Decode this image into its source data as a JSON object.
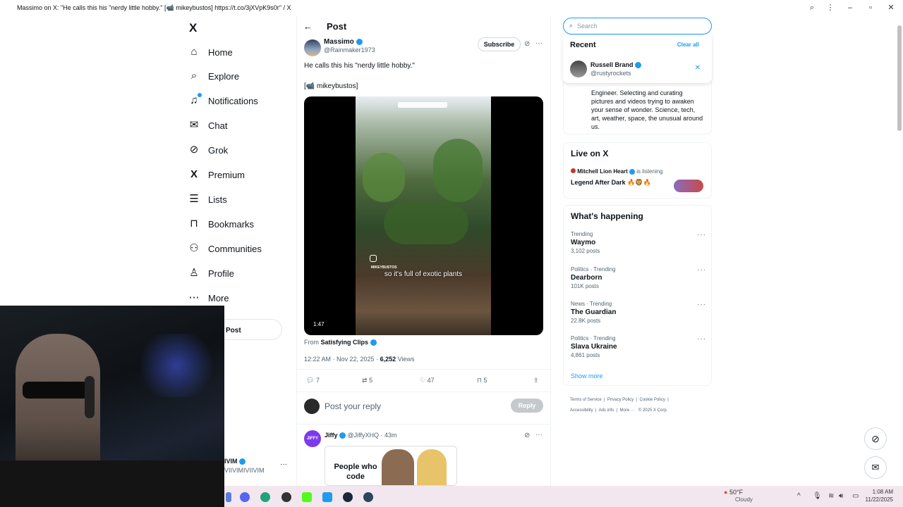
{
  "window": {
    "title": "Massimo on X: \"He calls this his \"nerdy little hobby.\" [📹 mikeybustos] https://t.co/3jXVpK9s0r\" / X"
  },
  "nav": {
    "logo": "X",
    "items": [
      {
        "label": "Home",
        "icon": "home-icon"
      },
      {
        "label": "Explore",
        "icon": "search-icon"
      },
      {
        "label": "Notifications",
        "icon": "bell-icon"
      },
      {
        "label": "Chat",
        "icon": "mail-icon"
      },
      {
        "label": "Grok",
        "icon": "grok-icon"
      },
      {
        "label": "Premium",
        "icon": "x-icon"
      },
      {
        "label": "Lists",
        "icon": "list-icon"
      },
      {
        "label": "Bookmarks",
        "icon": "bookmark-icon"
      },
      {
        "label": "Communities",
        "icon": "people-icon"
      },
      {
        "label": "Profile",
        "icon": "person-icon"
      },
      {
        "label": "More",
        "icon": "more-icon"
      }
    ],
    "post_button": "Post",
    "account_name": "IVIM",
    "account_handle": "VIIVIMIVIIVIM"
  },
  "header": {
    "title": "Post"
  },
  "post": {
    "author": "Massimo",
    "handle": "@Rainmaker1973",
    "subscribe": "Subscribe",
    "text": "He calls this his \"nerdy little hobby.\"",
    "credit": "[📹 mikeybustos]",
    "video_caption": "so it's full of exotic plants",
    "video_watermark": "MIKEYBUSTOS",
    "duration": "1:47",
    "from_label": "From",
    "from_source": "Satisfying Clips",
    "timestamp": "12:22 AM · Nov 22, 2025 · ",
    "views_count": "6,252",
    "views_label": " Views",
    "stats": {
      "replies": "7",
      "reposts": "5",
      "likes": "47",
      "bookmarks": "5"
    },
    "reply_placeholder": "Post your reply",
    "reply_button": "Reply"
  },
  "next_post": {
    "author": "Jiffy",
    "handle": "@JiffyXHQ",
    "time": "· 43m",
    "meme_text": "People who code"
  },
  "search": {
    "placeholder": "Search"
  },
  "recent": {
    "title": "Recent",
    "clear": "Clear all",
    "items": [
      {
        "name": "Russell Brand",
        "handle": "@rustyrockets"
      }
    ]
  },
  "bio_snippet": "Engineer. Selecting and curating pictures and videos trying to awaken your sense of wonder. Science, tech, art, weather, space, the unusual around us.",
  "live": {
    "title": "Live on X",
    "host": "Mitchell Lion Heart",
    "status": "is listening",
    "space": "Legend After Dark 🔥🦁🔥"
  },
  "happening": {
    "title": "What's happening",
    "trends": [
      {
        "meta": "Trending",
        "name": "Waymo",
        "count": "3,102 posts"
      },
      {
        "meta": "Politics · Trending",
        "name": "Dearborn",
        "count": "101K posts"
      },
      {
        "meta": "News · Trending",
        "name": "The Guardian",
        "count": "22.8K posts"
      },
      {
        "meta": "Politics · Trending",
        "name": "Slava Ukraine",
        "count": "4,861 posts"
      }
    ],
    "show_more": "Show more"
  },
  "footer": {
    "links": [
      "Terms of Service",
      "Privacy Policy",
      "Cookie Policy",
      "Accessibility",
      "Ads info",
      "More ···",
      "© 2025 X Corp."
    ]
  },
  "taskbar": {
    "weather_temp": "50°F",
    "weather_desc": "Cloudy",
    "time": "1:08 AM",
    "date": "11/22/2025"
  },
  "colors": {
    "accent": "#1d9bf0",
    "text": "#0f1419",
    "muted": "#536471",
    "border": "#eff3f4",
    "verified": "#1d9bf0"
  }
}
